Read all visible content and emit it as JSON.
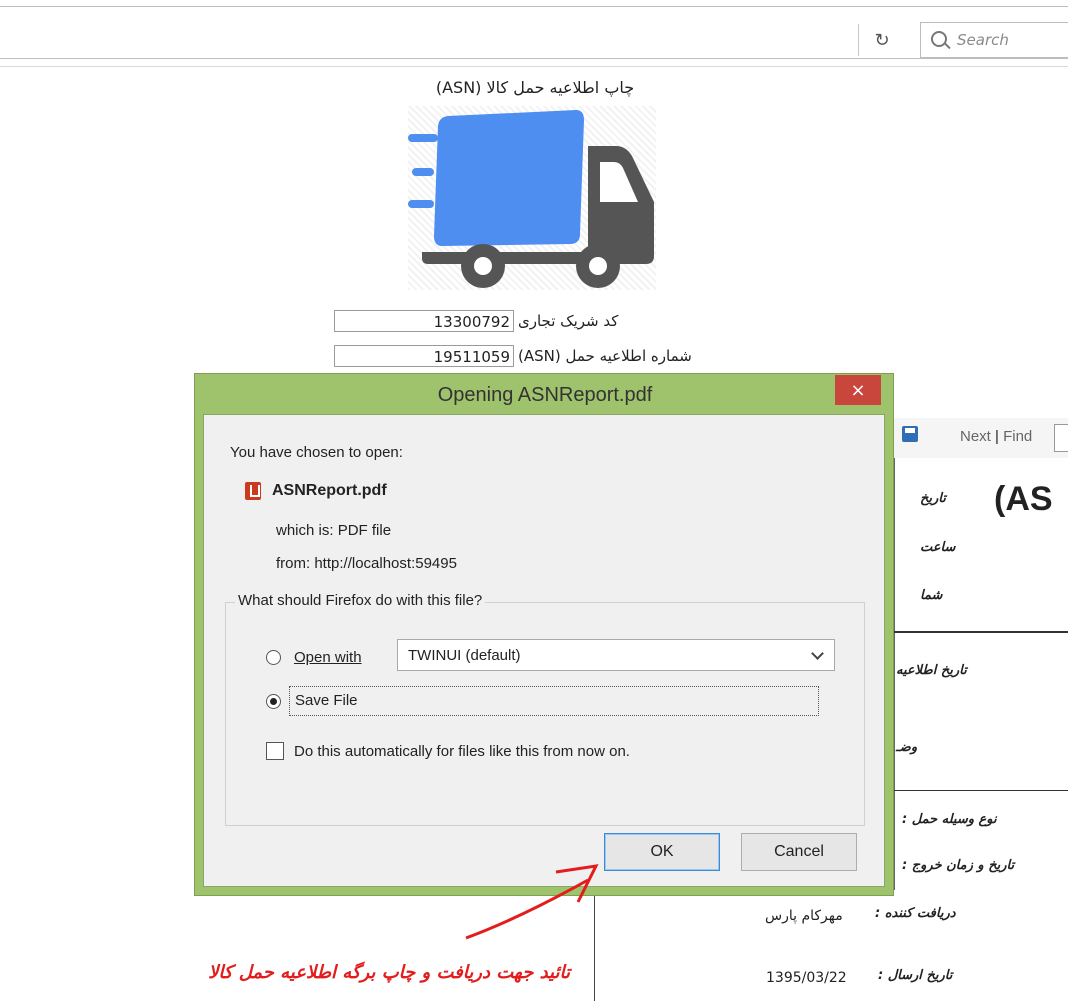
{
  "browser": {
    "search_placeholder": "Search"
  },
  "page": {
    "title": "چاپ اطلاعیه حمل کالا (ASN)",
    "fields": [
      {
        "label": "کد شریک تجاری",
        "value": "13300792"
      },
      {
        "label": "شماره اطلاعیه حمل (ASN)",
        "value": "19511059"
      }
    ]
  },
  "report": {
    "toolbar": {
      "next": "Next",
      "separator": "|",
      "find": "Find"
    },
    "heading_fragment": "(AS",
    "labels": {
      "date": "تاریخ",
      "time": "ساعت",
      "number": "شما",
      "notice_date": "تاریخ اطلاعیه",
      "status": "وضـ",
      "vehicle_type": "نوع وسیله حمل :",
      "exit_datetime": "تاریخ و زمان خروج :",
      "receiver": "دریافت کننده :",
      "send_date": "تاریخ ارسال :"
    },
    "values": {
      "receiver": "مهرکام پارس",
      "send_date": "1395/03/22"
    }
  },
  "dialog": {
    "title": "Opening ASNReport.pdf",
    "close_label": "×",
    "chosen_text": "You have chosen to open:",
    "file_name": "ASNReport.pdf",
    "which_is_label": "which is:",
    "which_is_value": "PDF file",
    "from_label": "from:",
    "from_value": "http://localhost:59495",
    "question": "What should Firefox do with this file?",
    "open_with_label": "Open with",
    "open_with_app": "TWINUI (default)",
    "save_file_label": "Save File",
    "selected_option": "Save File",
    "auto_label": "Do this automatically for files like this from now on.",
    "auto_checked": false,
    "ok_label": "OK",
    "cancel_label": "Cancel"
  },
  "annotation": {
    "text": "تائید جهت دریافت و چاپ برگه اطلاعیه حمل کالا",
    "color": "#e31d1d"
  },
  "colors": {
    "dialog_frame": "#9fc26c",
    "close_button": "#c9463d",
    "truck_blue": "#4d8ef0",
    "truck_gray": "#555555"
  },
  "icons": [
    "reload-icon",
    "search-icon",
    "truck-icon",
    "save-icon",
    "pdf-icon",
    "close-icon",
    "chevron-down-icon",
    "arrow-icon"
  ]
}
